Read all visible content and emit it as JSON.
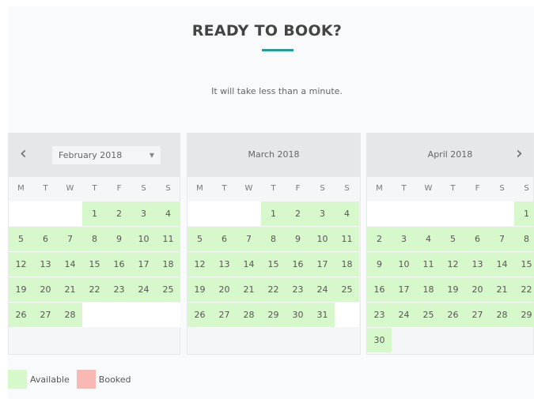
{
  "header": {
    "title": "READY TO BOOK?",
    "subtitle": "It will take less than a minute."
  },
  "weekdays": [
    "M",
    "T",
    "W",
    "T",
    "F",
    "S",
    "S"
  ],
  "calendars": [
    {
      "month": "February 2018",
      "weeks": [
        [
          "",
          "",
          "",
          "1",
          "2",
          "3",
          "4"
        ],
        [
          "5",
          "6",
          "7",
          "8",
          "9",
          "10",
          "11"
        ],
        [
          "12",
          "13",
          "14",
          "15",
          "16",
          "17",
          "18"
        ],
        [
          "19",
          "20",
          "21",
          "22",
          "23",
          "24",
          "25"
        ],
        [
          "26",
          "27",
          "28",
          "",
          "",
          "",
          ""
        ],
        [
          "",
          "",
          "",
          "",
          "",
          "",
          ""
        ]
      ]
    },
    {
      "month": "March 2018",
      "weeks": [
        [
          "",
          "",
          "",
          "1",
          "2",
          "3",
          "4"
        ],
        [
          "5",
          "6",
          "7",
          "8",
          "9",
          "10",
          "11"
        ],
        [
          "12",
          "13",
          "14",
          "15",
          "16",
          "17",
          "18"
        ],
        [
          "19",
          "20",
          "21",
          "22",
          "23",
          "24",
          "25"
        ],
        [
          "26",
          "27",
          "28",
          "29",
          "30",
          "31",
          ""
        ],
        [
          "",
          "",
          "",
          "",
          "",
          "",
          ""
        ]
      ]
    },
    {
      "month": "April 2018",
      "weeks": [
        [
          "",
          "",
          "",
          "",
          "",
          "",
          "1"
        ],
        [
          "2",
          "3",
          "4",
          "5",
          "6",
          "7",
          "8"
        ],
        [
          "9",
          "10",
          "11",
          "12",
          "13",
          "14",
          "15"
        ],
        [
          "16",
          "17",
          "18",
          "19",
          "20",
          "21",
          "22"
        ],
        [
          "23",
          "24",
          "25",
          "26",
          "27",
          "28",
          "29"
        ],
        [
          "30",
          "",
          "",
          "",
          "",
          "",
          ""
        ]
      ]
    }
  ],
  "legend": {
    "available": {
      "label": "Available",
      "color": "#d6f8cb"
    },
    "booked": {
      "label": "Booked",
      "color": "#f8b9b5"
    }
  },
  "icons": {
    "prev": "chevron-left-icon",
    "next": "chevron-right-icon",
    "dropdown": "caret-down-icon"
  }
}
